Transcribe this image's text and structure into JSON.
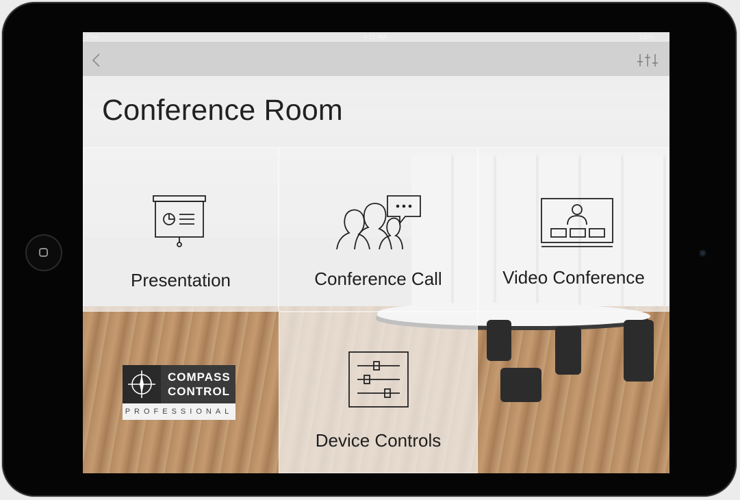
{
  "status_bar": {
    "carrier": "iPad",
    "time": "9:23 AM",
    "battery": "100%"
  },
  "nav": {
    "back_icon": "chevron-left-icon",
    "settings_icon": "sliders-icon"
  },
  "page": {
    "title": "Conference Room"
  },
  "tiles": [
    {
      "label": "Presentation",
      "icon": "projector-screen-icon"
    },
    {
      "label": "Conference Call",
      "icon": "people-chat-icon"
    },
    {
      "label": "Video Conference",
      "icon": "video-monitor-icon"
    },
    {
      "label": "Device Controls",
      "icon": "sliders-panel-icon"
    }
  ],
  "brand": {
    "line1": "COMPASS",
    "line2": "CONTROL",
    "line3": "PROFESSIONAL",
    "icon": "compass-icon"
  },
  "colors": {
    "text": "#222222",
    "tile_background": "#f4f4f4",
    "frame": "#050505"
  }
}
